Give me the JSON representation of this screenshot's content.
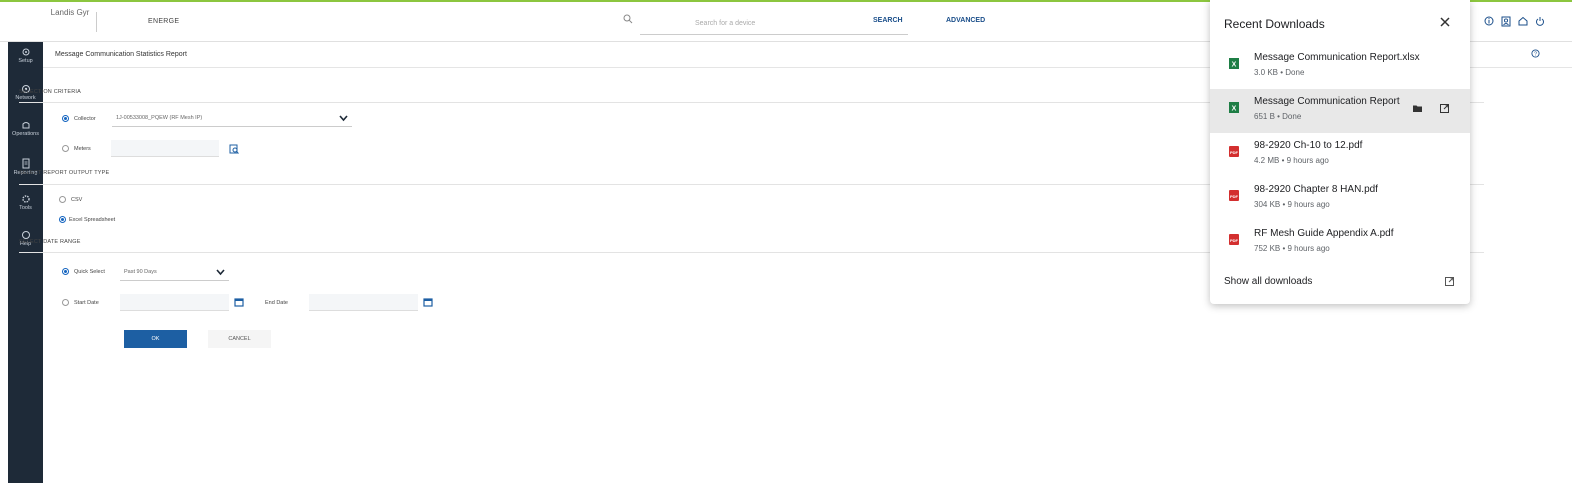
{
  "header": {
    "logo": "Landis Gyr",
    "app_name": "ENERGE",
    "search_placeholder": "Search for a device",
    "search_label": "SEARCH",
    "advanced_label": "ADVANCED",
    "icons": [
      "info-icon",
      "user-icon",
      "home-icon",
      "power-icon"
    ]
  },
  "sidebar": {
    "items": [
      {
        "label": "Setup",
        "icon": "gear-icon"
      },
      {
        "label": "Network",
        "icon": "network-icon"
      },
      {
        "label": "Operations",
        "icon": "operations-icon"
      },
      {
        "label": "Reporting",
        "icon": "report-icon"
      },
      {
        "label": "Tools",
        "icon": "tools-icon"
      },
      {
        "label": "Help",
        "icon": "help-icon"
      }
    ]
  },
  "page": {
    "title": "Message Communication Statistics Report",
    "selection_criteria": "SELECTION CRITERIA",
    "collector_label": "Collector",
    "collector_value": "1J-00533008_PQEW (RF Mesh IP)",
    "meters_label": "Meters",
    "output_type_header": "SELECT REPORT OUTPUT TYPE",
    "csv_label": "CSV",
    "excel_label": "Excel Spreadsheet",
    "date_range_header": "SELECT DATE RANGE",
    "quick_select_label": "Quick Select",
    "quick_select_value": "Past 90 Days",
    "start_date_label": "Start Date",
    "end_date_label": "End Date",
    "ok_label": "OK",
    "cancel_label": "CANCEL"
  },
  "downloads": {
    "title": "Recent Downloads",
    "items": [
      {
        "name": "Message Communication Report.xlsx",
        "meta": "3.0 KB • Done",
        "type": "excel"
      },
      {
        "name": "Message Communication Report",
        "meta": "651 B • Done",
        "type": "excel"
      },
      {
        "name": "98-2920 Ch-10 to 12.pdf",
        "meta": "4.2 MB • 9 hours ago",
        "type": "pdf"
      },
      {
        "name": "98-2920 Chapter 8 HAN.pdf",
        "meta": "304 KB • 9 hours ago",
        "type": "pdf"
      },
      {
        "name": "RF Mesh Guide Appendix A.pdf",
        "meta": "752 KB • 9 hours ago",
        "type": "pdf"
      }
    ],
    "show_all": "Show all downloads"
  }
}
